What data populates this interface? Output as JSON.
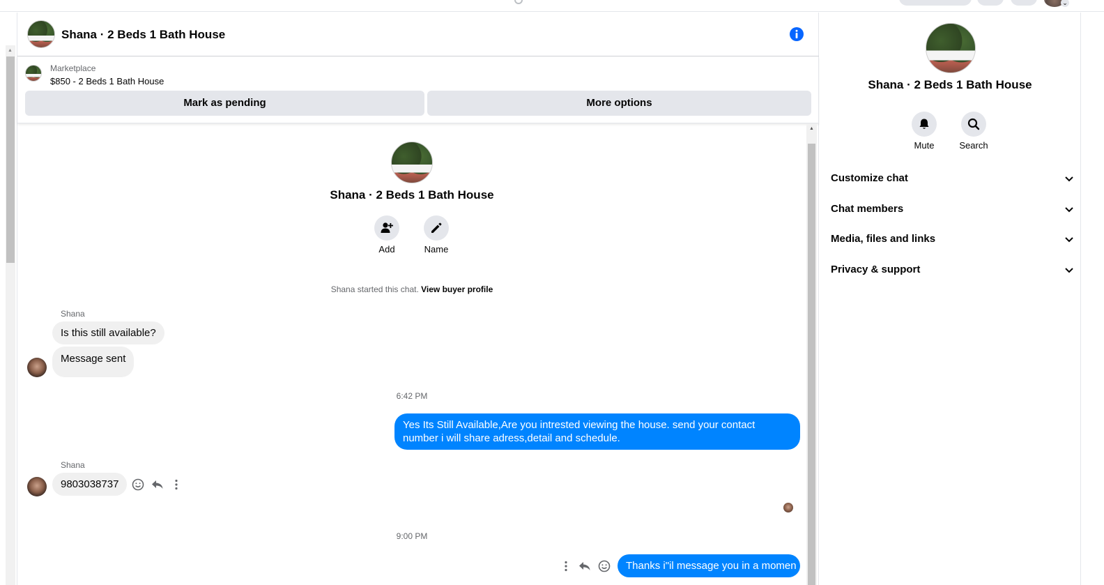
{
  "header": {
    "title": "Shana · 2 Beds 1 Bath House"
  },
  "listing": {
    "source": "Marketplace",
    "price_title": "$850 - 2 Beds 1 Bath House",
    "mark_pending_label": "Mark as pending",
    "more_options_label": "More options"
  },
  "intro": {
    "title": "Shana · 2 Beds 1 Bath House",
    "add_label": "Add",
    "name_label": "Name",
    "started_text": "Shana started this chat.",
    "view_profile_link": "View buyer profile"
  },
  "messages": [
    {
      "sender": "Shana",
      "text": "Is this still available?"
    },
    {
      "text": "Message sent"
    },
    {
      "timestamp": "6:42 PM"
    },
    {
      "text": "Yes Its Still Available,Are you intrested viewing the house. send your contact number i will share adress,detail and schedule."
    },
    {
      "sender": "Shana",
      "text": "9803038737"
    },
    {
      "timestamp": "9:00 PM"
    },
    {
      "text": "Thanks i\"il message you in a momen"
    }
  ],
  "side": {
    "title": "Shana · 2 Beds 1 Bath House",
    "mute_label": "Mute",
    "search_label": "Search",
    "sections": [
      "Customize chat",
      "Chat members",
      "Media, files and links",
      "Privacy & support"
    ]
  },
  "colors": {
    "accent": "#0084ff",
    "bubble_in": "#f0f0f0",
    "button_gray": "#e4e6eb",
    "secondary_text": "#65676b"
  }
}
